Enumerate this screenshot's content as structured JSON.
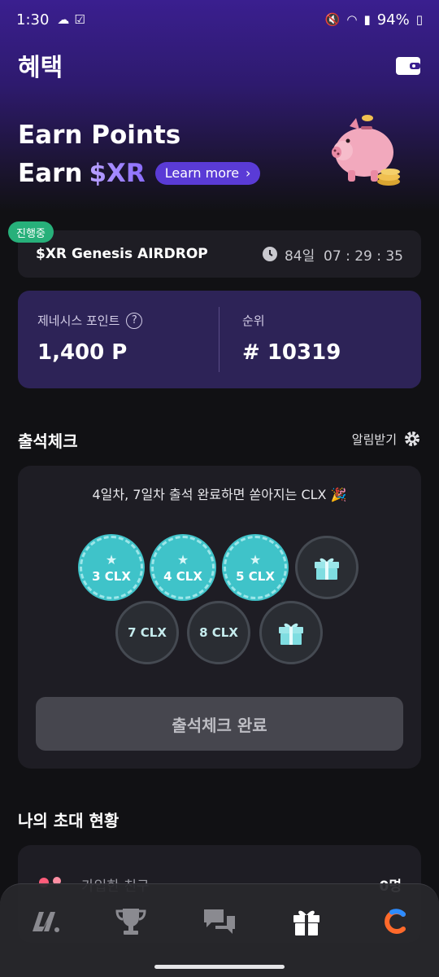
{
  "status_bar": {
    "time": "1:30",
    "battery": "94%"
  },
  "header": {
    "title": "혜택"
  },
  "hero": {
    "line1": "Earn Points",
    "line2_prefix": "Earn",
    "line2_token": "$XR",
    "learn_more": "Learn more"
  },
  "airdrop": {
    "badge": "진행중",
    "title": "$XR Genesis AIRDROP",
    "countdown": "84일  07 : 29 : 35"
  },
  "points": {
    "genesis_label": "제네시스 포인트",
    "genesis_value": "1,400 P",
    "rank_label": "순위",
    "rank_value": "# 10319"
  },
  "attendance": {
    "title": "출석체크",
    "alarm_label": "알림받기",
    "message": "4일차, 7일차 출석 완료하면 쏟아지는 CLX 🎉",
    "days": [
      {
        "label": "3 CLX",
        "state": "done"
      },
      {
        "label": "4 CLX",
        "state": "done"
      },
      {
        "label": "5 CLX",
        "state": "done"
      },
      {
        "label": "",
        "state": "gift"
      },
      {
        "label": "7 CLX",
        "state": "pending"
      },
      {
        "label": "8 CLX",
        "state": "pending"
      },
      {
        "label": "",
        "state": "gift"
      }
    ],
    "complete_button": "출석체크 완료"
  },
  "invite": {
    "title": "나의 초대 현황",
    "row_label": "가입한 친구",
    "row_value": "0명"
  },
  "nav": {
    "items": [
      "home-icon",
      "trophy-icon",
      "chat-icon",
      "gift-icon",
      "profile-icon"
    ]
  },
  "colors": {
    "accent": "#5a3bd6",
    "teal": "#3fc3c9",
    "badge_green": "#27b07a"
  }
}
